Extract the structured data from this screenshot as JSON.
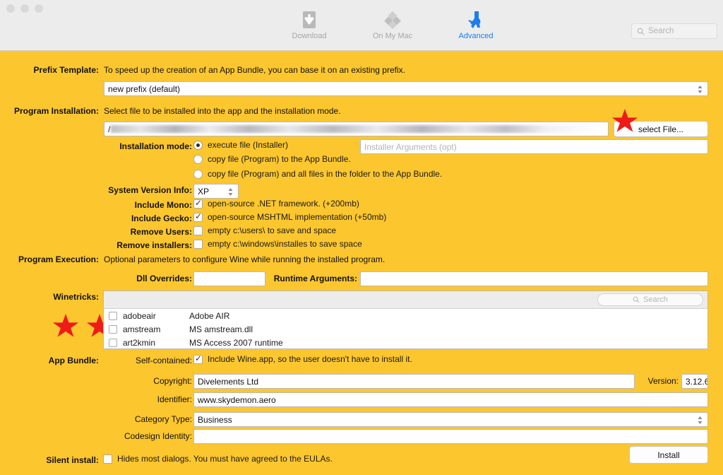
{
  "window": {
    "traffic_lights": [
      "close",
      "minimize",
      "zoom"
    ]
  },
  "toolbar": {
    "tabs": [
      {
        "label": "Download",
        "icon": "download-arrow-icon",
        "active": false
      },
      {
        "label": "On My Mac",
        "icon": "diamond-cluster-icon",
        "active": false
      },
      {
        "label": "Advanced",
        "icon": "wrench-tools-icon",
        "active": true
      }
    ],
    "search_placeholder": "Search",
    "search_icon": "search-icon",
    "active_color": "#1a7ef0",
    "inactive_color": "#a6a6a6"
  },
  "theme": {
    "background": "#fcc62f",
    "annotation": "#ee1b18"
  },
  "prefix_template": {
    "label": "Prefix Template:",
    "description": "To speed up the creation of an App Bundle, you can base it on an existing prefix.",
    "selected": "new prefix (default)"
  },
  "program_installation": {
    "label": "Program Installation:",
    "description": "Select file to be installed into the app and the installation mode.",
    "file_path": "/",
    "select_file_button": "select File...",
    "installation_mode_label": "Installation mode:",
    "modes": [
      {
        "label": "execute file (Installer)",
        "selected": true
      },
      {
        "label": "copy file (Program)  to the App Bundle.",
        "selected": false
      },
      {
        "label": "copy file (Program)  and all files in the folder to the App Bundle.",
        "selected": false
      }
    ],
    "installer_arguments_placeholder": "Installer Arguments (opt)",
    "system_version_label": "System Version Info:",
    "system_version_value": "XP",
    "options": [
      {
        "label": "Include Mono:",
        "text": "open-source .NET framework. (+200mb)",
        "checked": true
      },
      {
        "label": "Include Gecko:",
        "text": "open-source MSHTML implementation (+50mb)",
        "checked": true
      },
      {
        "label": "Remove Users:",
        "text": "empty c:\\users\\ to save and space",
        "checked": false
      },
      {
        "label": "Remove installers:",
        "text": "empty c:\\windows\\installes to save space",
        "checked": false
      }
    ]
  },
  "program_execution": {
    "label": "Program Execution:",
    "description": "Optional parameters to configure Wine while running the installed program.",
    "dll_overrides_label": "Dll Overrides:",
    "dll_overrides_value": "",
    "runtime_arguments_label": "Runtime Arguments:",
    "runtime_arguments_value": ""
  },
  "winetricks": {
    "label": "Winetricks:",
    "search_placeholder": "Search",
    "search_icon": "search-icon",
    "rows": [
      {
        "name": "adobeair",
        "description": "Adobe AIR",
        "checked": false
      },
      {
        "name": "amstream",
        "description": "MS amstream.dll",
        "checked": false
      },
      {
        "name": "art2kmin",
        "description": "MS Access 2007 runtime",
        "checked": false
      }
    ]
  },
  "app_bundle": {
    "label": "App Bundle:",
    "self_contained_label": "Self-contained:",
    "self_contained_text": "Include Wine.app, so the user doesn't have to install it.",
    "self_contained_checked": true,
    "copyright_label": "Copyright:",
    "copyright_value": "Divelements Ltd",
    "version_label": "Version:",
    "version_value": "3.12.6",
    "identifier_label": "Identifier:",
    "identifier_value": "www.skydemon.aero",
    "category_label": "Category Type:",
    "category_value": "Business",
    "codesign_label": "Codesign Identity:",
    "codesign_value": ""
  },
  "silent_install": {
    "label": "Silent install:",
    "text": "Hides most dialogs. You must have agreed to the EULAs.",
    "checked": false
  },
  "install_button": {
    "label": "Install"
  }
}
